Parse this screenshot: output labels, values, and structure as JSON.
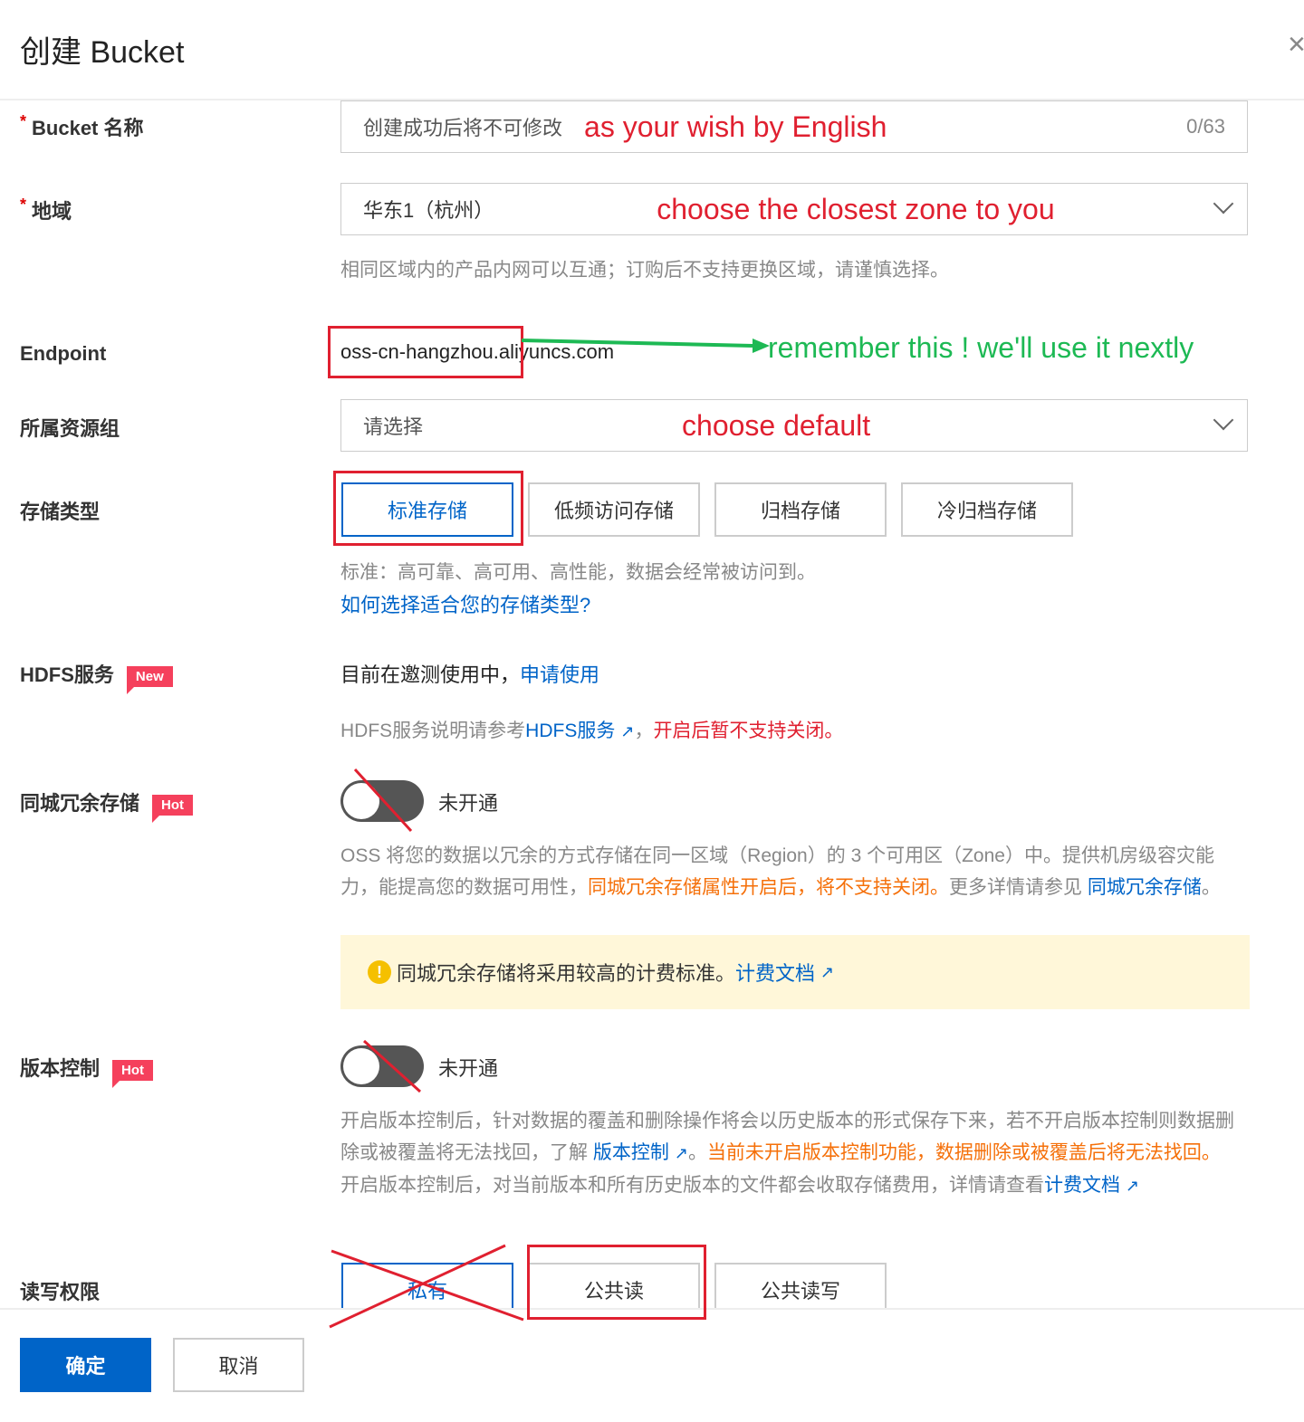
{
  "dialog": {
    "title": "创建 Bucket",
    "close": "×"
  },
  "bucket_name": {
    "label": "Bucket 名称",
    "required": "*",
    "placeholder": "创建成功后将不可修改",
    "counter": "0/63",
    "annotation": "as your wish by English"
  },
  "region": {
    "label": "地域",
    "required": "*",
    "value": "华东1（杭州）",
    "annotation": "choose the closest zone to you",
    "hint": "相同区域内的产品内网可以互通；订购后不支持更换区域，请谨慎选择。"
  },
  "endpoint": {
    "label": "Endpoint",
    "value": "oss-cn-hangzhou.aliyuncs.com",
    "annotation": "remember this ! we'll use it nextly"
  },
  "resource_group": {
    "label": "所属资源组",
    "placeholder": "请选择",
    "annotation": "choose default"
  },
  "storage_type": {
    "label": "存储类型",
    "options": [
      "标准存储",
      "低频访问存储",
      "归档存储",
      "冷归档存储"
    ],
    "selected": 0,
    "hint": "标准：高可靠、高可用、高性能，数据会经常被访问到。",
    "link": "如何选择适合您的存储类型?"
  },
  "hdfs": {
    "label": "HDFS服务",
    "badge": "New",
    "status": "目前在邀测使用中，",
    "apply_link": "申请使用",
    "desc_prefix": "HDFS服务说明请参考",
    "desc_link": "HDFS服务",
    "desc_sep": "，",
    "desc_warn": "开启后暂不支持关闭。"
  },
  "zone_redundant": {
    "label": "同城冗余存储",
    "badge": "Hot",
    "toggle_state": "未开通",
    "desc1": "OSS 将您的数据以冗余的方式存储在同一区域（Region）的 3 个可用区（Zone）中。提供机房级容灾能力，能提高您的数据可用性，",
    "desc_warn": "同城冗余存储属性开启后，将不支持关闭。",
    "desc2": "更多详情请参见 ",
    "desc_link": "同城冗余存储",
    "desc_end": "。",
    "notice": "同城冗余存储将采用较高的计费标准。",
    "notice_link": "计费文档"
  },
  "versioning": {
    "label": "版本控制",
    "badge": "Hot",
    "toggle_state": "未开通",
    "desc1": "开启版本控制后，针对数据的覆盖和删除操作将会以历史版本的形式保存下来，若不开启版本控制则数据删除或被覆盖将无法找回，了解 ",
    "desc_link": "版本控制",
    "desc_sep": "。",
    "desc_warn": "当前未开启版本控制功能，数据删除或被覆盖后将无法找回。",
    "desc3": "开启版本控制后，对当前版本和所有历史版本的文件都会收取存储费用，详情请查看",
    "desc3_link": "计费文档"
  },
  "acl": {
    "label": "读写权限",
    "options": [
      "私有",
      "公共读",
      "公共读写"
    ],
    "selected": 0
  },
  "footer": {
    "confirm": "确定",
    "cancel": "取消"
  },
  "colors": {
    "primary": "#0064c8",
    "annotation_red": "#e02030",
    "annotation_green": "#1db954"
  }
}
